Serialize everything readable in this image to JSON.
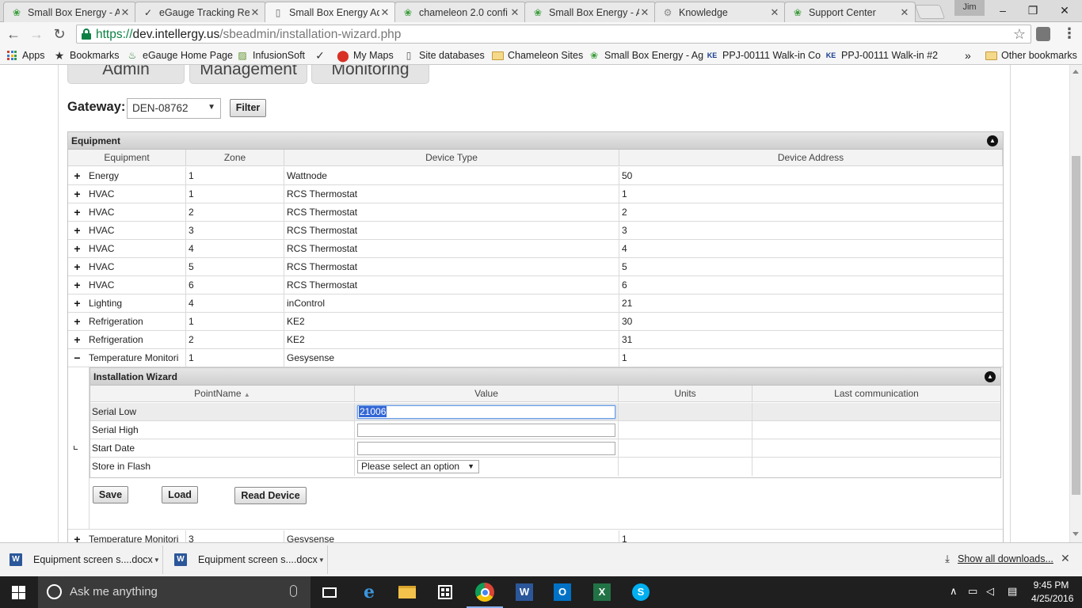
{
  "browser": {
    "tabs": [
      {
        "label": "Small Box Energy - A",
        "icon": "leaf-icon"
      },
      {
        "label": "eGauge Tracking Rep",
        "icon": "check-icon"
      },
      {
        "label": "Small Box Energy Ad",
        "icon": "page-icon",
        "active": true
      },
      {
        "label": "chameleon 2.0 confi",
        "icon": "leaf-icon"
      },
      {
        "label": "Small Box Energy - A",
        "icon": "leaf-icon"
      },
      {
        "label": "Knowledge",
        "icon": "gear-icon"
      },
      {
        "label": "Support Center",
        "icon": "leaf-icon"
      }
    ],
    "profile": "Jim",
    "url": {
      "scheme": "https://",
      "host": "dev.intellergy.us",
      "path": "/sbeadmin/installation-wizard.php"
    },
    "bookmarks": [
      {
        "label": "Apps"
      },
      {
        "label": "Bookmarks"
      },
      {
        "label": "eGauge Home Page"
      },
      {
        "label": "InfusionSoft"
      },
      {
        "label": ""
      },
      {
        "label": "My Maps"
      },
      {
        "label": "Site databases"
      },
      {
        "label": "Chameleon Sites"
      },
      {
        "label": "Small Box Energy - Ag"
      },
      {
        "label": "PPJ-00111 Walk-in Co"
      },
      {
        "label": "PPJ-00111 Walk-in #2"
      }
    ],
    "more_bookmarks": "»",
    "other_bookmarks": "Other bookmarks"
  },
  "page": {
    "nav_tabs": [
      "Admin",
      "Management",
      "Monitoring"
    ],
    "gateway_label": "Gateway:",
    "gateway_value": "DEN-08762",
    "filter_label": "Filter",
    "equipment_panel": {
      "title": "Equipment",
      "columns": [
        "Equipment",
        "Zone",
        "Device Type",
        "Device Address"
      ],
      "rows": [
        {
          "expander": "+",
          "equipment": "Energy",
          "zone": "1",
          "device_type": "Wattnode",
          "address": "50"
        },
        {
          "expander": "+",
          "equipment": "HVAC",
          "zone": "1",
          "device_type": "RCS Thermostat",
          "address": "1"
        },
        {
          "expander": "+",
          "equipment": "HVAC",
          "zone": "2",
          "device_type": "RCS Thermostat",
          "address": "2"
        },
        {
          "expander": "+",
          "equipment": "HVAC",
          "zone": "3",
          "device_type": "RCS Thermostat",
          "address": "3"
        },
        {
          "expander": "+",
          "equipment": "HVAC",
          "zone": "4",
          "device_type": "RCS Thermostat",
          "address": "4"
        },
        {
          "expander": "+",
          "equipment": "HVAC",
          "zone": "5",
          "device_type": "RCS Thermostat",
          "address": "5"
        },
        {
          "expander": "+",
          "equipment": "HVAC",
          "zone": "6",
          "device_type": "RCS Thermostat",
          "address": "6"
        },
        {
          "expander": "+",
          "equipment": "Lighting",
          "zone": "4",
          "device_type": "inControl",
          "address": "21"
        },
        {
          "expander": "+",
          "equipment": "Refrigeration",
          "zone": "1",
          "device_type": "KE2",
          "address": "30"
        },
        {
          "expander": "+",
          "equipment": "Refrigeration",
          "zone": "2",
          "device_type": "KE2",
          "address": "31"
        },
        {
          "expander": "−",
          "equipment": "Temperature Monitori",
          "zone": "1",
          "device_type": "Gesysense",
          "address": "1"
        }
      ],
      "last_row": {
        "expander": "+",
        "equipment": "Temperature Monitori",
        "zone": "3",
        "device_type": "Gesysense",
        "address": "1"
      }
    },
    "wizard": {
      "title": "Installation Wizard",
      "columns": [
        "PointName",
        "Value",
        "Units",
        "Last communication"
      ],
      "sort_indicator": "▲",
      "rows": [
        {
          "name": "Serial Low",
          "value": "21006",
          "units": "",
          "last": ""
        },
        {
          "name": "Serial High",
          "value": "",
          "units": "",
          "last": ""
        },
        {
          "name": "Start Date",
          "value": "",
          "units": "",
          "last": ""
        },
        {
          "name": "Store in Flash",
          "value": "Please select an option",
          "units": "",
          "last": ""
        }
      ],
      "save_label": "Save",
      "load_label": "Load",
      "read_label": "Read Device"
    }
  },
  "downloads": {
    "items": [
      "Equipment screen s....docx",
      "Equipment screen s....docx"
    ],
    "show_all": "Show all downloads..."
  },
  "taskbar": {
    "search_placeholder": "Ask me anything",
    "time": "9:45 PM",
    "date": "4/25/2016"
  }
}
